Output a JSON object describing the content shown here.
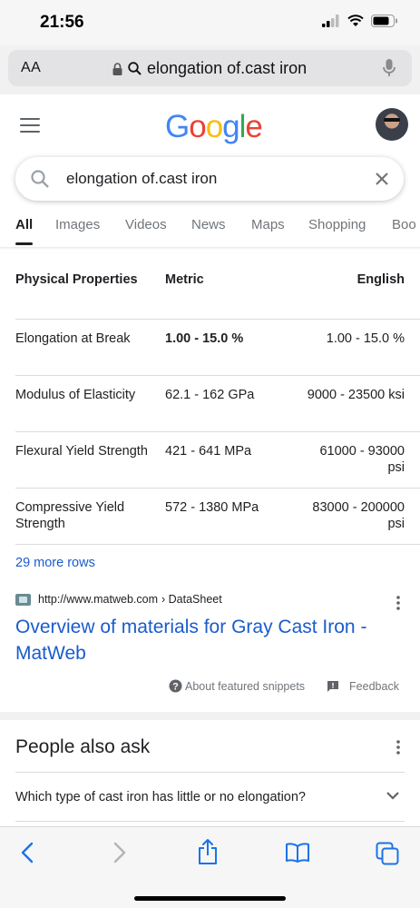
{
  "status": {
    "time": "21:56"
  },
  "url_bar": {
    "aa_label": "AA",
    "query": "elongation of.cast iron"
  },
  "search": {
    "query": "elongation of.cast iron"
  },
  "logo": {
    "letters": [
      "G",
      "o",
      "o",
      "g",
      "l",
      "e"
    ],
    "colors": [
      "#4285F4",
      "#EA4335",
      "#FBBC05",
      "#4285F4",
      "#34A853",
      "#EA4335"
    ]
  },
  "tabs": [
    {
      "label": "All",
      "active": true
    },
    {
      "label": "Images"
    },
    {
      "label": "Videos"
    },
    {
      "label": "News"
    },
    {
      "label": "Maps"
    },
    {
      "label": "Shopping"
    },
    {
      "label": "Boo"
    }
  ],
  "table": {
    "headers": [
      "Physical Properties",
      "Metric",
      "English"
    ],
    "rows": [
      [
        "Elongation at Break",
        "1.00 - 15.0 %",
        "1.00 - 15.0 %"
      ],
      [
        "Modulus of Elasticity",
        "62.1 - 162 GPa",
        "9000 - 23500 ksi"
      ],
      [
        "Flexural Yield Strength",
        "421 - 641 MPa",
        "61000 - 93000 psi"
      ],
      [
        "Compressive Yield Strength",
        "572 - 1380 MPa",
        "83000 - 200000 psi"
      ]
    ]
  },
  "more_rows": "29 more rows",
  "result": {
    "url": "http://www.matweb.com",
    "breadcrumb": "› DataSheet",
    "title": "Overview of materials for Gray Cast Iron - MatWeb"
  },
  "footer": {
    "about": "About featured snippets",
    "feedback": "Feedback"
  },
  "paa": {
    "title": "People also ask",
    "question": "Which type of cast iron has little or no elongation?"
  },
  "colors": {
    "link": "#1a5ccc",
    "ios_blue": "#1a73e8"
  }
}
